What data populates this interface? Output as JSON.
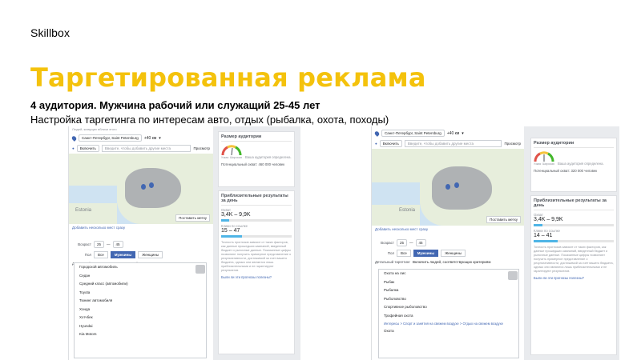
{
  "brand": "Skillbox",
  "title": "Таргетированная реклама",
  "subtitle": "4 аудитория. Мужчина рабочий или служащий 25-45 лет",
  "description": "Настройка таргетинга по интересам авто, отдых (рыбалка, охота, походы)",
  "colors": {
    "title": "#f4c20c",
    "accent": "#4267b2",
    "bar": "#4fb5e6"
  },
  "left": {
    "top_text": "Людей, живущих вблизи этого",
    "location": "Санкт-Петербург, Saint Petersburg",
    "radius": "+40 км",
    "include": "Включить",
    "search_placeholder": "Введите, чтобы добавить другие места",
    "browse": "Просмотр",
    "map_label": "Estonia",
    "map_button": "Поставить метку",
    "add_locations": "Добавить несколько мест сразу",
    "age_label": "Возраст",
    "age_from": "25",
    "age_to": "45",
    "gender_label": "Пол",
    "gender_all": "Все",
    "gender_men": "Мужчины",
    "gender_women": "Женщины",
    "detailed_label": "Детальный таргетинг",
    "detailed_text": "Включить людей, соответствующих критериям",
    "interests": [
      "Городской автомобиль",
      "Седан",
      "Средний класс (автомобили)",
      "Toyota",
      "Тюнинг автомобиля",
      "Хонда",
      "Хэтчбек",
      "Hyundai",
      "Kia Motors"
    ]
  },
  "right": {
    "location": "Санкт-Петербург, Saint Petersburg",
    "radius": "+40 км",
    "include": "Включить",
    "search_placeholder": "Введите, чтобы добавить другие места",
    "browse": "Просмотр",
    "map_label": "Estonia",
    "map_button": "Поставить метку",
    "add_locations": "Добавить несколько мест сразу",
    "age_label": "Возраст",
    "age_from": "25",
    "age_to": "45",
    "gender_label": "Пол",
    "gender_all": "Все",
    "gender_men": "Мужчины",
    "gender_women": "Женщины",
    "detailed_label": "Детальный таргетинг",
    "detailed_text": "Включить людей, соответствующих критериям",
    "interests": [
      "Охота на лис",
      "Рыбак",
      "Рыбалка",
      "Рыболовство",
      "Спортивное рыболовство",
      "Трофейная охота"
    ],
    "crumb": "Интересы > Спорт и занятия на свежем воздухе > Отдых на свежем воздухе",
    "last_item": "Охота"
  },
  "panelL": {
    "audience_title": "Размер аудитории",
    "audience_note": "Ваша аудитория определена.",
    "narrow": "Узкая",
    "broad": "Широкая",
    "potential": "Потенциальный охват: 460 000 человек",
    "results_title": "Приблизительные результаты за день",
    "reach_label": "Охват",
    "reach_value": "3,4K – 9,9K",
    "reach_fill": 0.11,
    "clicks_label": "Клики по ссылке",
    "clicks_value": "15 – 47",
    "clicks_fill": 0.3,
    "note": "Точность прогнозов зависит от таких факторов, как данные прошедших кампаний, введенный бюджет и рыночные данные. Показанные цифры позволяют получить примерное представление о результативности, достижимой за счет вашего бюджета, однако они являются лишь приблизительными и не гарантируют результатов.",
    "feedback": "Были ли эти прогнозы полезны?"
  },
  "panelR": {
    "audience_title": "Размер аудитории",
    "audience_note": "Ваша аудитория определена.",
    "narrow": "Узкая",
    "broad": "Широкая",
    "potential": "Потенциальный охват: 320 000 человек",
    "results_title": "Приблизительные результаты за день",
    "reach_label": "Охват",
    "reach_value": "3,4K – 9,9K",
    "reach_fill": 0.11,
    "clicks_label": "Клики по ссылке",
    "clicks_value": "14 – 41",
    "clicks_fill": 0.3,
    "note": "Точность прогнозов зависит от таких факторов, как данные прошедших кампаний, введенный бюджет и рыночные данные. Показанные цифры позволяют получить примерное представление о результативности, достижимой за счет вашего бюджета, однако они являются лишь приблизительными и не гарантируют результатов.",
    "feedback": "Были ли эти прогнозы полезны?"
  }
}
